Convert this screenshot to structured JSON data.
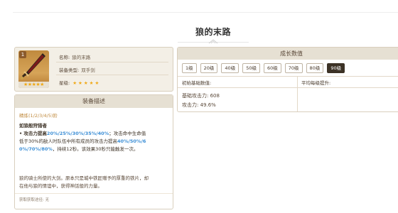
{
  "page": {
    "title": "狼的末路"
  },
  "weapon": {
    "rarity_badge": "1",
    "card_stars": "★★★★★",
    "name_label": "名称:",
    "name_value": "狼的末路",
    "type_label": "装备类型:",
    "type_value": "双手剑",
    "star_label": "星级:",
    "star_value": "★★★★★"
  },
  "description": {
    "header": "装备描述",
    "refine": "精炼(1/2/3/4/5)阶",
    "skill_name": "如狼般狩猎者",
    "line1_a": "• 攻击力提高",
    "line1_hl": "20%/25%/30%/35%/40%",
    "line1_b": "；攻击命中生命值",
    "line2_a": "低于30%的敌人时队伍中所有成员的攻击力提高",
    "line2_hl": "40%/50%/6",
    "line3_hl": "0%/70%/80%",
    "line3_b": "，持续12秒。该效果30秒只能触发一次。",
    "story_1": "狼的骑士所使的大剑。原本只是城中铁匠赠予的厚重的铁片，却",
    "story_2": "在他与狼的情谊中，获得神話般的力量。",
    "source": "获取获取途径: 无"
  },
  "growth": {
    "header": "成长数值",
    "levels": [
      "1级",
      "20级",
      "40级",
      "50级",
      "60级",
      "70级",
      "80级",
      "90级"
    ],
    "active_level": "90级",
    "col_base": "初始基础数值:",
    "col_avg": "平均每级提升:",
    "base_attack": "基础攻击力: 608",
    "attack_pct": "攻击力: 49.6%"
  },
  "colors": {
    "accent": "#3d8fd6",
    "gold": "#c08a3e",
    "star": "#f0a814"
  }
}
